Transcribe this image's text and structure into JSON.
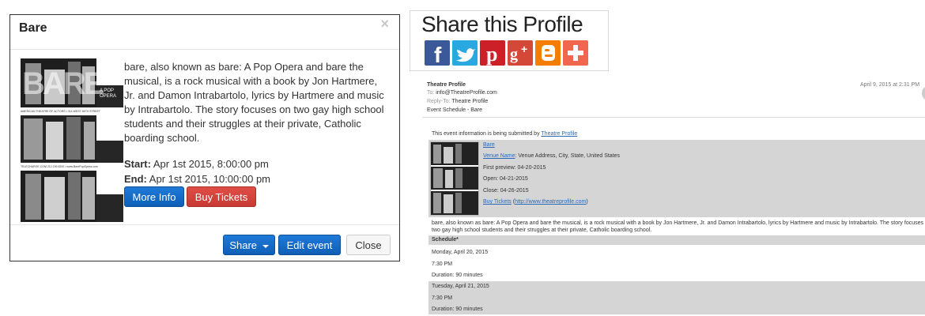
{
  "modal": {
    "title": "Bare",
    "close_glyph": "×",
    "poster": {
      "big_text": "BARE",
      "side_text": "A POP OPERA",
      "strip_text_1": "AMERICAN THEATRE OF ACTORS • 314 WEST 54TH STREET",
      "strip_text_2": "TELECHARGE.COM 212.239.6200 • www.BarePopOpera.com"
    },
    "description": "bare, also known as bare: A Pop Opera and bare the musical, is a rock musical with a book by Jon Hartmere, Jr. and Damon Intrabartolo, lyrics by Hartmere and music by Intrabartolo. The story focuses on two gay high school students and their struggles at their private, Catholic boarding school.",
    "start_label": "Start:",
    "start_value": "Apr 1st 2015, 8:00:00 pm",
    "end_label": "End:",
    "end_value": "Apr 1st 2015, 10:00:00 pm",
    "more_info_label": "More Info",
    "buy_tickets_label": "Buy Tickets",
    "share_label": "Share",
    "edit_event_label": "Edit event",
    "close_label": "Close"
  },
  "share": {
    "title": "Share this Profile",
    "icons": [
      {
        "name": "facebook-icon",
        "glyph": "f",
        "color": "#3b5998"
      },
      {
        "name": "twitter-icon",
        "glyph": "t",
        "color": "#2aa9e0"
      },
      {
        "name": "pinterest-icon",
        "glyph": "p",
        "color": "#cb2027"
      },
      {
        "name": "google-plus-icon",
        "glyph": "g+",
        "color": "#d34836"
      },
      {
        "name": "blogger-icon",
        "glyph": "B",
        "color": "#f57d00"
      },
      {
        "name": "addthis-icon",
        "glyph": "+",
        "color": "#f1664f"
      }
    ]
  },
  "email": {
    "from": "Theatre Profile",
    "date": "April 9, 2015 at 2:31 PM",
    "to_label": "To:",
    "to_value": "info@TheatreProfile.com",
    "reply_label": "Reply-To:",
    "reply_value": "Theatre Profile",
    "subject": "Event Schedule - Bare",
    "intro_text": "This event information is being submitted by",
    "intro_link": "Theatre Profile",
    "event_name": "Bare",
    "venue_link": "Venue Name",
    "venue_address": ": Venue Address, City, State, United States",
    "first_preview": "First preview: 04-20-2015",
    "open": "Open: 04-21-2015",
    "close": "Close: 04-26-2015",
    "buy_tickets_link": "Buy Tickets",
    "buy_tickets_url": "http://www.theatreprofile.com",
    "description": "bare, also known as bare: A Pop Opera and bare the musical, is a rock musical with a book by Jon Hartmere, Jr. and Damon Intrabartolo, lyrics by Hartmere and music by Intrabartolo. The story focuses on two gay high school students and their struggles at their private, Catholic boarding school.",
    "schedule_header": "Schedule*",
    "schedule": [
      {
        "date": "Monday, April 20, 2015",
        "time": "7:30 PM",
        "duration": "Duration: 90 minutes"
      },
      {
        "date": "Tuesday, April 21, 2015",
        "time": "7:30 PM",
        "duration": "Duration: 90 minutes"
      }
    ]
  }
}
